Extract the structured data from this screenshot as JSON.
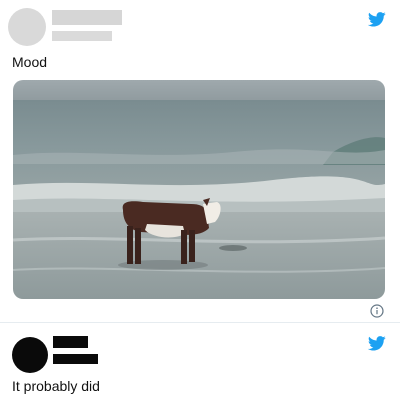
{
  "tweets": [
    {
      "text": "Mood",
      "has_media": true,
      "media_description_icon": "photo"
    },
    {
      "text": "It probably did"
    }
  ],
  "icons": {
    "brand": "twitter-bird-icon",
    "info": "info-icon"
  },
  "colors": {
    "twitter_blue": "#1da1f2",
    "redacted_light": "#d6d6d6",
    "redacted_dark": "#0a0a0a",
    "divider": "#e6ecf0"
  }
}
